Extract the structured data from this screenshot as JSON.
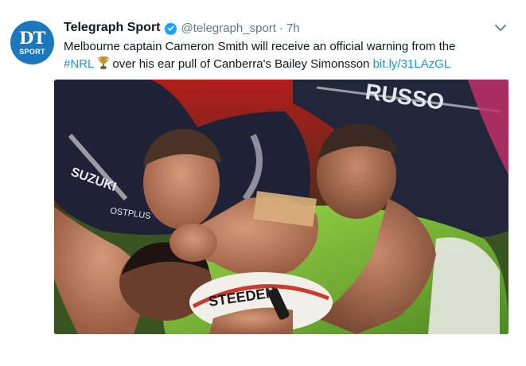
{
  "tweet": {
    "avatar": {
      "monogram": "DT",
      "sub": "SPORT",
      "color": "#1b78be"
    },
    "author_name": "Telegraph Sport",
    "verified": true,
    "handle": "@telegraph_sport",
    "separator": "·",
    "time": "7h",
    "text": {
      "line1": "Melbourne captain Cameron Smith will receive an official warning from the",
      "hashtag": "#NRL",
      "emoji": "trophy-emoji",
      "line2_rest": "over his ear pull of Canberra's Bailey Simonsson",
      "link": "bit.ly/31LAzGL"
    },
    "media": {
      "photo_jersey_text": {
        "left_sleeve": "SUZUKI",
        "left_chest": "OSTPLUS",
        "top_back": "RUSSO",
        "ball": "STEEDEN"
      }
    }
  },
  "colors": {
    "link": "#1b95e0",
    "secondary_text": "#657786",
    "verified": "#1da1f2"
  }
}
